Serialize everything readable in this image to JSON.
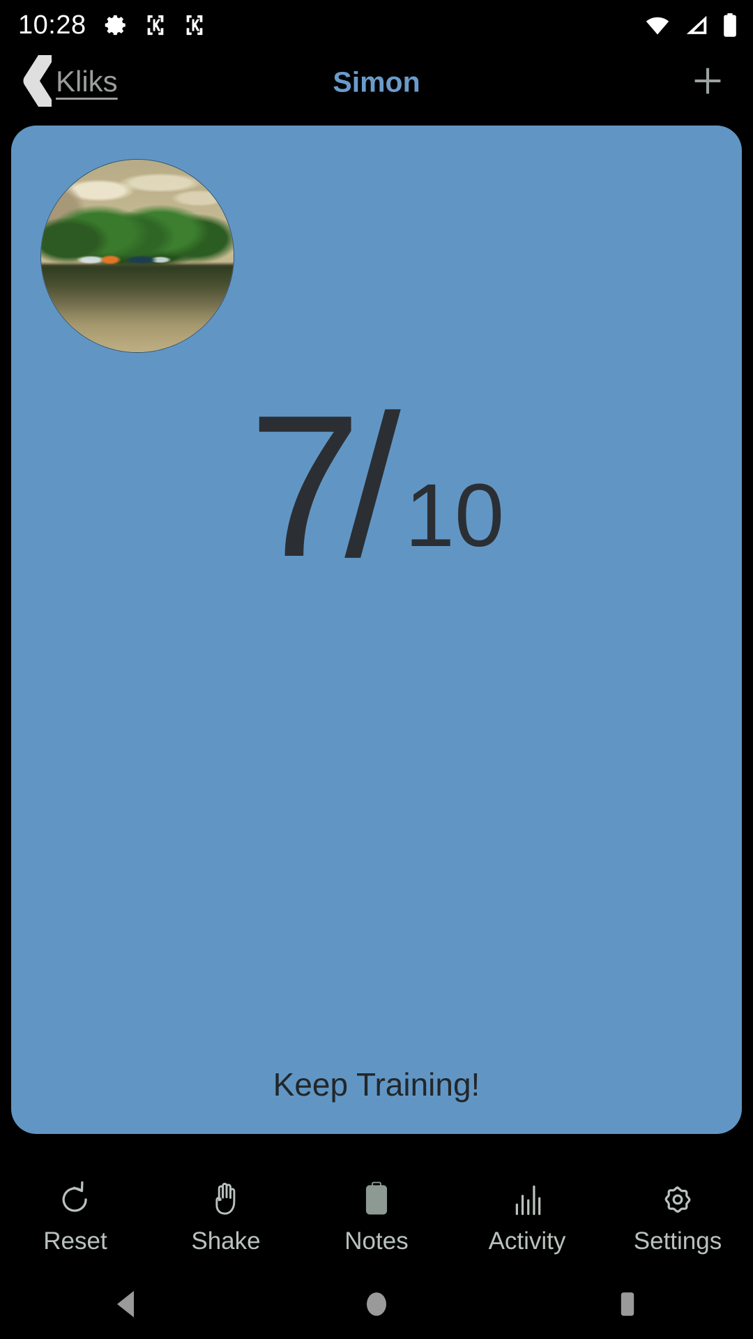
{
  "status_bar": {
    "time": "10:28",
    "left_icons": [
      "gear-icon",
      "kliks-notification-icon",
      "kliks-notification-icon"
    ],
    "right_icons": [
      "wifi-icon",
      "cellular-signal-icon",
      "battery-icon"
    ]
  },
  "nav_bar": {
    "back_label": "Kliks",
    "title": "Simon",
    "add_label": "+"
  },
  "card": {
    "background_color": "#6196c4",
    "avatar_alt": "lake-landscape-photo",
    "counter": {
      "value": "7",
      "separator": "/",
      "goal": "10"
    },
    "motivation": "Keep Training!"
  },
  "tab_bar": {
    "items": [
      {
        "label": "Reset",
        "icon": "refresh-icon"
      },
      {
        "label": "Shake",
        "icon": "hand-icon"
      },
      {
        "label": "Notes",
        "icon": "clipboard-icon"
      },
      {
        "label": "Activity",
        "icon": "bar-chart-icon"
      },
      {
        "label": "Settings",
        "icon": "gear-icon"
      }
    ]
  },
  "system_nav": {
    "back": "back-triangle-icon",
    "home": "home-circle-icon",
    "recents": "recents-square-icon"
  },
  "colors": {
    "card_blue": "#6196c4",
    "title_blue": "#6a9ccb",
    "counter_dark": "#2b2f33",
    "tab_label": "#b9c2bd"
  }
}
